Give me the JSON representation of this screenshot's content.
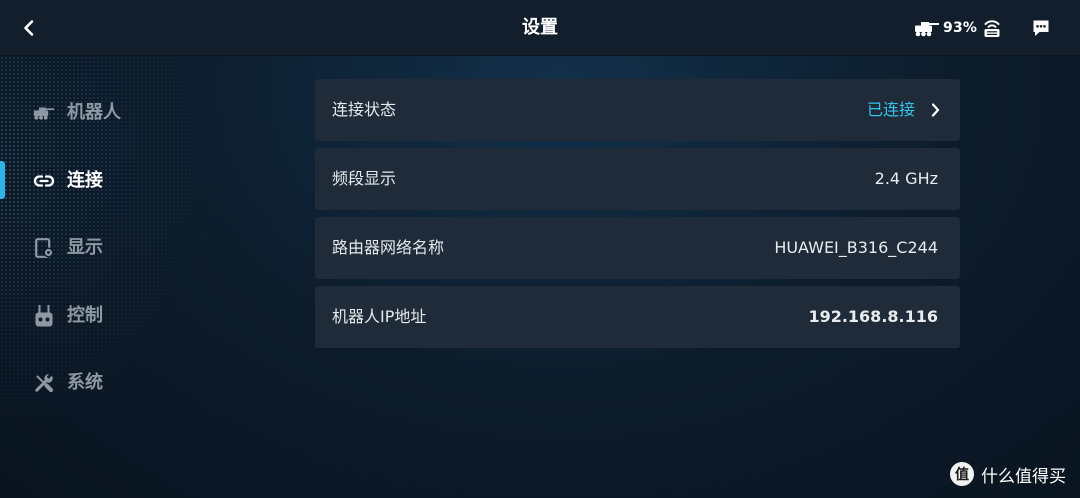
{
  "header": {
    "title": "设置",
    "battery_percent": "93%",
    "icons": {
      "back": "chevron-left-icon",
      "robot_status": "robot-icon",
      "network": "router-icon",
      "messages": "message-icon"
    }
  },
  "sidebar": {
    "active_index": 1,
    "items": [
      {
        "label": "机器人",
        "icon": "robot-icon"
      },
      {
        "label": "连接",
        "icon": "link-icon"
      },
      {
        "label": "显示",
        "icon": "display-settings-icon"
      },
      {
        "label": "控制",
        "icon": "controller-icon"
      },
      {
        "label": "系统",
        "icon": "tools-icon"
      }
    ]
  },
  "main": {
    "rows": [
      {
        "label": "连接状态",
        "value": "已连接",
        "has_chevron": true
      },
      {
        "label": "频段显示",
        "value": "2.4 GHz"
      },
      {
        "label": "路由器网络名称",
        "value": "HUAWEI_B316_C244"
      },
      {
        "label": "机器人IP地址",
        "value": "192.168.8.116"
      }
    ]
  },
  "watermark": {
    "logo_char": "值",
    "text": "什么值得买"
  },
  "colors": {
    "accent": "#33c3ee",
    "indicator": "#2fb4e8",
    "row_bg": "#1f2b38",
    "inactive": "#8e98a3",
    "topbar_bg": "#121e2c"
  }
}
